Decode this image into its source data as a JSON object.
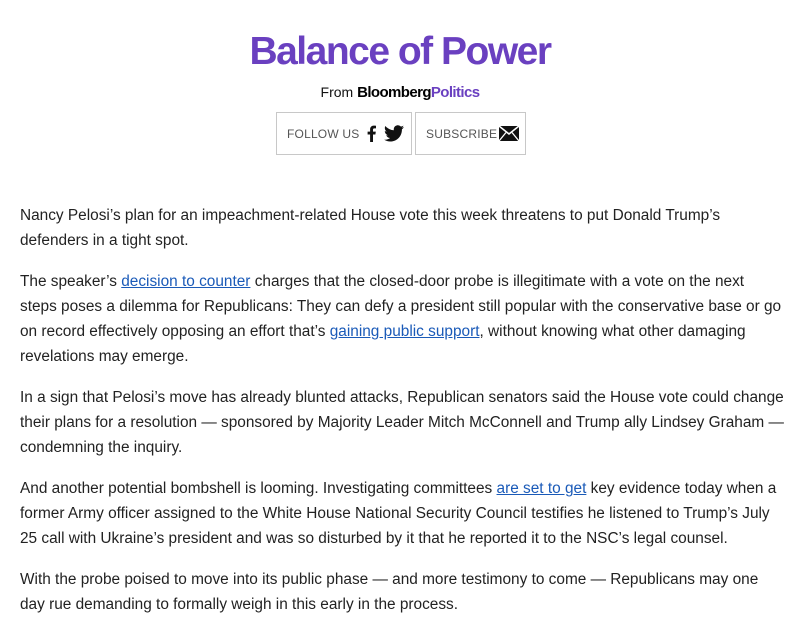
{
  "header": {
    "title": "Balance of Power",
    "from_label": "From",
    "brand_main": "Bloomberg",
    "brand_section": "Politics"
  },
  "buttons": {
    "follow_label": "FOLLOW US",
    "subscribe_label": "SUBSCRIBE",
    "icons": [
      "facebook-icon",
      "twitter-icon",
      "envelope-icon"
    ]
  },
  "colors": {
    "title": "#6a40c0",
    "link": "#1a5ab8",
    "text": "#222222"
  },
  "article": {
    "p1": "Nancy Pelosi’s plan for an impeachment-related House vote this week threatens to put Donald Trump’s defenders in a tight spot.",
    "p2_a": "The speaker’s ",
    "p2_link1": "decision to counter",
    "p2_b": " charges that the closed-door probe is illegitimate with a vote on the next steps poses a dilemma for Republicans: They can defy a president still popular with the conservative base or go on record effectively opposing an effort that’s ",
    "p2_link2": "gaining public support",
    "p2_c": ", without knowing what other damaging revelations may emerge.",
    "p3": "In a sign that Pelosi’s move has already blunted attacks, Republican senators said the House vote could change their plans for a resolution — sponsored by Majority Leader Mitch McConnell and Trump ally Lindsey Graham — condemning the inquiry.",
    "p4_a": "And another potential bombshell is looming. Investigating committees ",
    "p4_link": "are set to get",
    "p4_b": " key evidence today when a former Army officer assigned to the White House National Security Council testifies he listened to Trump’s July 25 call with Ukraine’s president and was so disturbed by it that he reported it to the NSC’s legal counsel.",
    "p5": "With the probe poised to move into its public phase — and more testimony to come — Republicans may one day rue demanding to formally weigh in this early in the process."
  }
}
